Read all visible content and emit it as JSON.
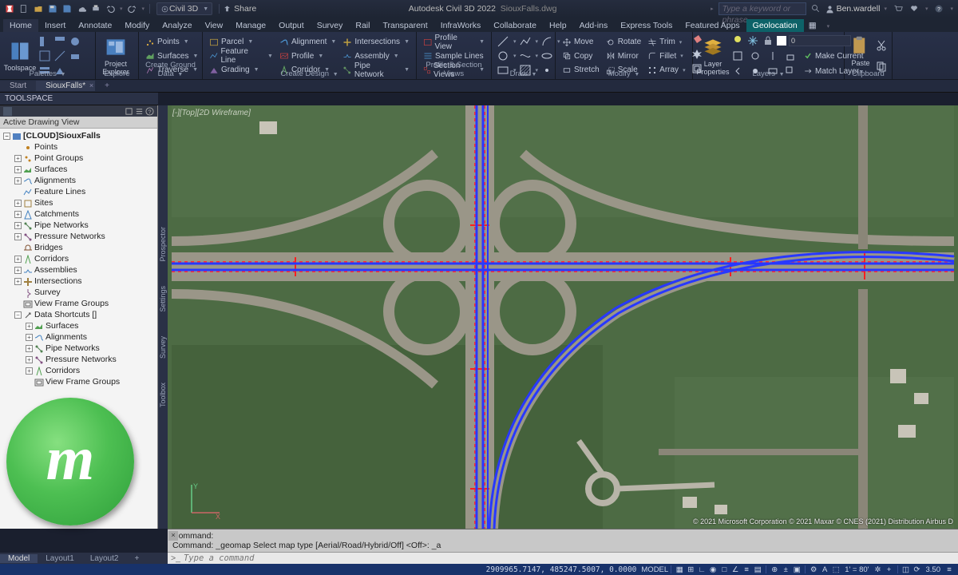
{
  "title": {
    "app": "Autodesk Civil 3D 2022",
    "doc": "SiouxFalls.dwg"
  },
  "titlebar": {
    "workspace": "Civil 3D",
    "share": "Share",
    "search_placeholder": "Type a keyword or phrase",
    "user": "Ben.wardell"
  },
  "menu": {
    "items": [
      "Home",
      "Insert",
      "Annotate",
      "Modify",
      "Analyze",
      "View",
      "Manage",
      "Output",
      "Survey",
      "Rail",
      "Transparent",
      "InfraWorks",
      "Collaborate",
      "Help",
      "Add-ins",
      "Express Tools",
      "Featured Apps",
      "Geolocation"
    ],
    "active": "Geolocation",
    "selected": "Home"
  },
  "ribbon": {
    "panels": {
      "palettes": "Palettes",
      "explore": "Explore",
      "ground": "Create Ground Data",
      "design": "Create Design",
      "profile": "Profile & Section Views",
      "draw": "Draw",
      "modify": "Modify",
      "layers": "Layers",
      "clipboard": "Clipboard"
    },
    "toolspace": "Toolspace",
    "project_explorer": "Project\nExplorer",
    "col1": [
      "Points",
      "Surfaces",
      "Traverse"
    ],
    "col2": [
      "Parcel",
      "Feature Line",
      "Grading"
    ],
    "col3": [
      "Alignment",
      "Profile",
      "Corridor"
    ],
    "col4": [
      "Intersections",
      "Assembly",
      "Pipe Network"
    ],
    "col5": [
      "Profile View",
      "Sample Lines",
      "Section Views"
    ],
    "modcol1": [
      "Move",
      "Copy",
      "Stretch"
    ],
    "modcol2": [
      "Rotate",
      "Mirror",
      "Scale"
    ],
    "modcol3": [
      "Trim",
      "Fillet",
      "Array"
    ],
    "laycol": [
      "Make Current",
      "Match Layer"
    ],
    "layer_value": "0",
    "layer_props": "Layer\nProperties",
    "paste": "Paste"
  },
  "filetabs": {
    "start": "Start",
    "doc": "SiouxFalls*"
  },
  "toolspace": {
    "title": "TOOLSPACE",
    "active_view": "Active Drawing View",
    "root": "[CLOUD]SiouxFalls",
    "nodes1": [
      "Points",
      "Point Groups",
      "Surfaces",
      "Alignments",
      "Feature Lines",
      "Sites",
      "Catchments",
      "Pipe Networks",
      "Pressure Networks",
      "Bridges",
      "Corridors",
      "Assemblies",
      "Intersections",
      "Survey",
      "View Frame Groups"
    ],
    "shortcuts": "Data Shortcuts []",
    "nodes2": [
      "Surfaces",
      "Alignments",
      "Pipe Networks",
      "Pressure Networks",
      "Corridors",
      "View Frame Groups"
    ]
  },
  "viewport": {
    "header": "[-][Top][2D Wireframe]",
    "attribution": "© 2021 Microsoft Corporation © 2021 Maxar © CNES (2021) Distribution Airbus D",
    "side_tabs": [
      "Prospector",
      "Settings",
      "Survey",
      "Toolbox"
    ]
  },
  "command": {
    "hist1": "Command:",
    "hist2": "Command:  _geomap Select map type [Aerial/Road/Hybrid/Off] <Off>:  _a",
    "prompt_placeholder": "Type a command"
  },
  "model_tabs": [
    "Model",
    "Layout1",
    "Layout2"
  ],
  "status": {
    "coords": "2909965.7147, 485247.5007, 0.0000",
    "model": "MODEL",
    "angle": "1' = 80'",
    "zoom": "3.50"
  },
  "colors": {
    "accent": "#0d6268",
    "ribbon": "#283048",
    "status": "#18326a"
  }
}
